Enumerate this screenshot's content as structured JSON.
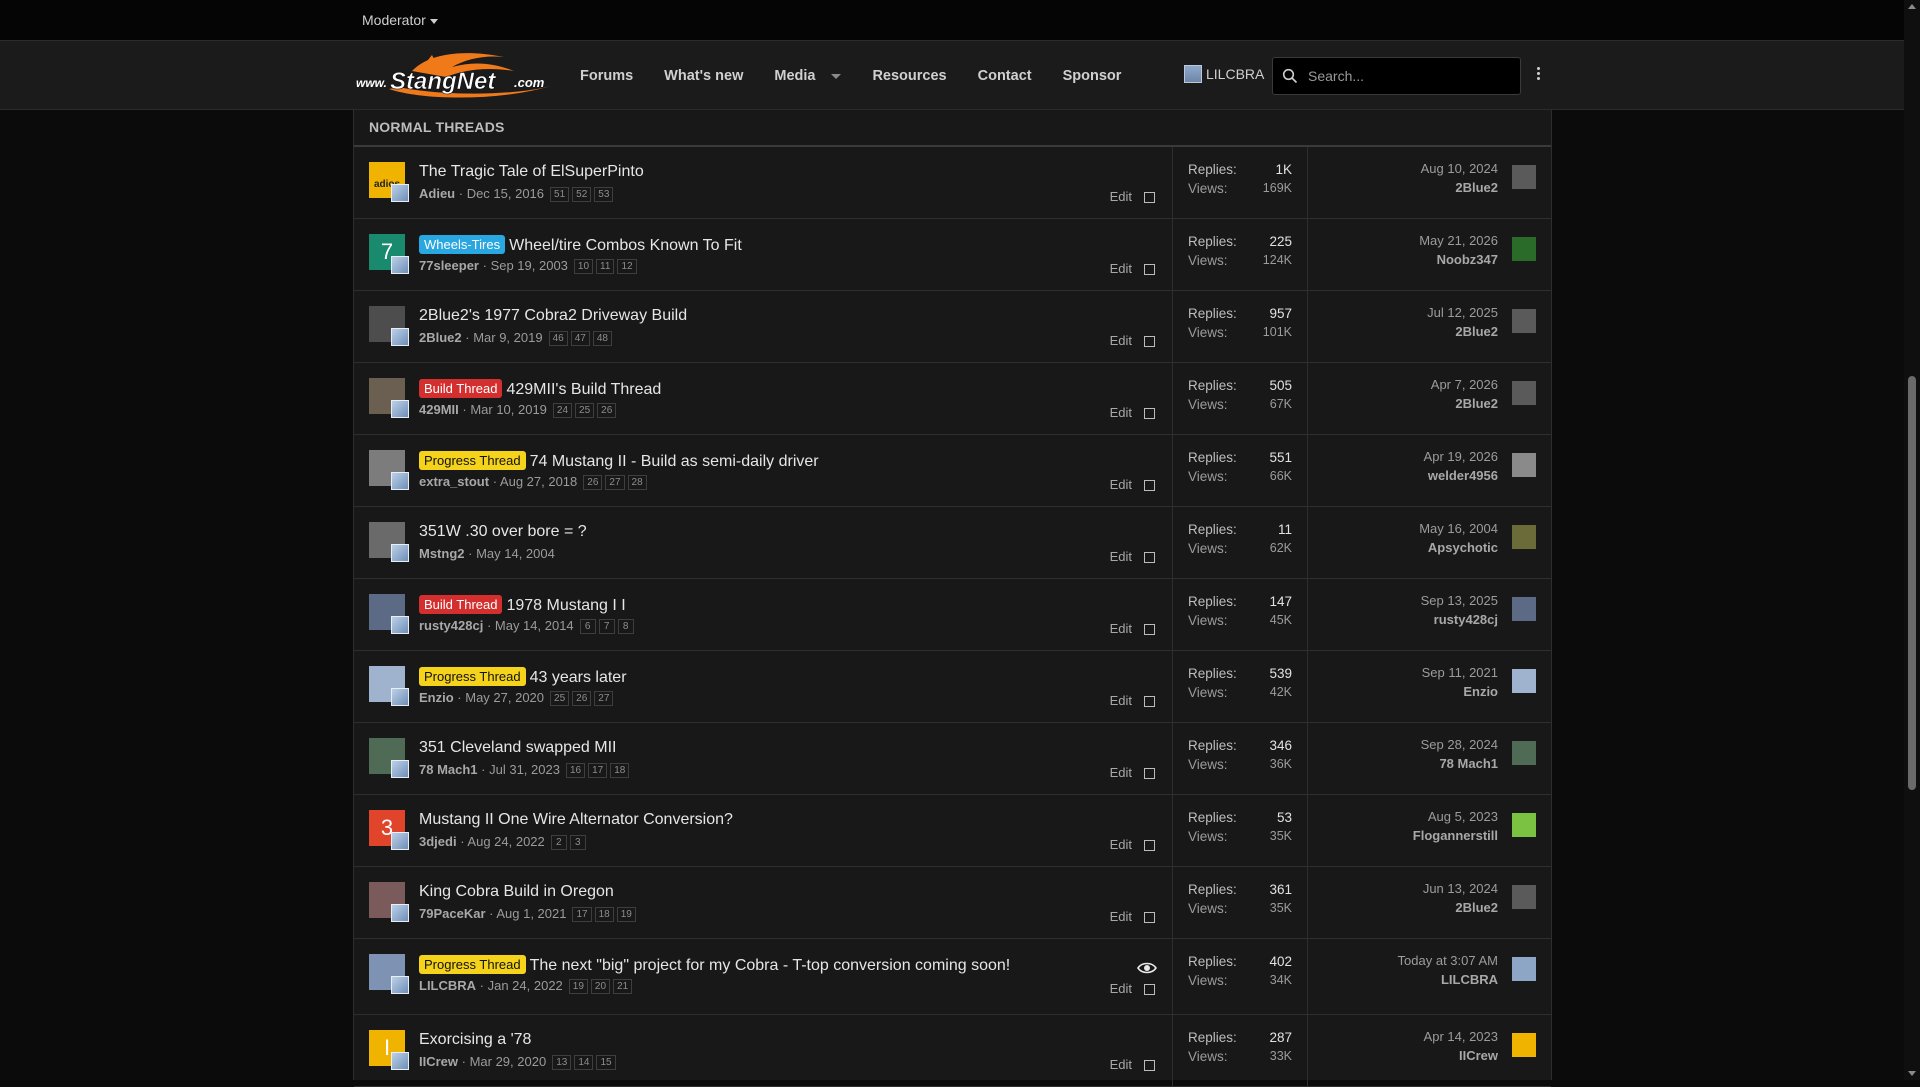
{
  "topbar": {
    "moderator_label": "Moderator"
  },
  "nav": {
    "logo_text": "www.StangNet.com",
    "items": [
      "Forums",
      "What's new",
      "Media",
      "Resources",
      "Contact",
      "Sponsor"
    ],
    "username": "LILCBRA",
    "search_placeholder": "Search..."
  },
  "section_title": "NORMAL THREADS",
  "edit_label": "Edit",
  "replies_label": "Replies:",
  "views_label": "Views:",
  "colors": {
    "background": "#181818",
    "wheels_tires_prefix": "#29a7e1",
    "build_thread_prefix": "#d32f2f",
    "progress_thread_prefix": "#f5d31b"
  },
  "threads": [
    {
      "title": "The Tragic Tale of ElSuperPinto",
      "prefix": "",
      "author": "Adieu",
      "date": "Dec 15, 2016",
      "pages": [
        "51",
        "52",
        "53"
      ],
      "replies": "1K",
      "views": "169K",
      "last_date": "Aug 10, 2024",
      "last_user": "2Blue2",
      "avatar_letter": "adios",
      "avatar_color": "#f0b400",
      "last_avatar_color": "#5a5a5a",
      "watched": false
    },
    {
      "title": "Wheel/tire Combos Known To Fit",
      "prefix": "Wheels-Tires",
      "author": "77sleeper",
      "date": "Sep 19, 2003",
      "pages": [
        "10",
        "11",
        "12"
      ],
      "replies": "225",
      "views": "124K",
      "last_date": "May 21, 2026",
      "last_user": "Noobz347",
      "avatar_letter": "7",
      "avatar_color": "#1a8a6e",
      "last_avatar_color": "#2a6b2a",
      "watched": false
    },
    {
      "title": "2Blue2's 1977 Cobra2 Driveway Build",
      "prefix": "",
      "author": "2Blue2",
      "date": "Mar 9, 2019",
      "pages": [
        "46",
        "47",
        "48"
      ],
      "replies": "957",
      "views": "101K",
      "last_date": "Jul 12, 2025",
      "last_user": "2Blue2",
      "avatar_letter": "",
      "avatar_color": "#4d4d4d",
      "last_avatar_color": "#5a5a5a",
      "watched": false
    },
    {
      "title": "429MII's Build Thread",
      "prefix": "Build Thread",
      "author": "429MII",
      "date": "Mar 10, 2019",
      "pages": [
        "24",
        "25",
        "26"
      ],
      "replies": "505",
      "views": "67K",
      "last_date": "Apr 7, 2026",
      "last_user": "2Blue2",
      "avatar_letter": "",
      "avatar_color": "#6b5f52",
      "last_avatar_color": "#5a5a5a",
      "watched": false
    },
    {
      "title": "74 Mustang II - Build as semi-daily driver",
      "prefix": "Progress Thread",
      "author": "extra_stout",
      "date": "Aug 27, 2018",
      "pages": [
        "26",
        "27",
        "28"
      ],
      "replies": "551",
      "views": "66K",
      "last_date": "Apr 19, 2026",
      "last_user": "welder4956",
      "avatar_letter": "",
      "avatar_color": "#7c7c7c",
      "last_avatar_color": "#8a8a8a",
      "watched": false
    },
    {
      "title": "351W .30 over bore = ?",
      "prefix": "",
      "author": "Mstng2",
      "date": "May 14, 2004",
      "pages": [],
      "replies": "11",
      "views": "62K",
      "last_date": "May 16, 2004",
      "last_user": "Apsychotic",
      "avatar_letter": "",
      "avatar_color": "#6a6a6a",
      "last_avatar_color": "#6b6b3a",
      "watched": false
    },
    {
      "title": "1978 Mustang I I",
      "prefix": "Build Thread",
      "author": "rusty428cj",
      "date": "May 14, 2014",
      "pages": [
        "6",
        "7",
        "8"
      ],
      "replies": "147",
      "views": "45K",
      "last_date": "Sep 13, 2025",
      "last_user": "rusty428cj",
      "avatar_letter": "",
      "avatar_color": "#5d6a86",
      "last_avatar_color": "#5d6a86",
      "watched": false
    },
    {
      "title": "43 years later",
      "prefix": "Progress Thread",
      "author": "Enzio",
      "date": "May 27, 2020",
      "pages": [
        "25",
        "26",
        "27"
      ],
      "replies": "539",
      "views": "42K",
      "last_date": "Sep 11, 2021",
      "last_user": "Enzio",
      "avatar_letter": "",
      "avatar_color": "#9fb3cf",
      "last_avatar_color": "#9fb3cf",
      "watched": false
    },
    {
      "title": "351 Cleveland swapped MII",
      "prefix": "",
      "author": "78 Mach1",
      "date": "Jul 31, 2023",
      "pages": [
        "16",
        "17",
        "18"
      ],
      "replies": "346",
      "views": "36K",
      "last_date": "Sep 28, 2024",
      "last_user": "78 Mach1",
      "avatar_letter": "",
      "avatar_color": "#4f6a55",
      "last_avatar_color": "#4f6a55",
      "watched": false
    },
    {
      "title": "Mustang II One Wire Alternator Conversion?",
      "prefix": "",
      "author": "3djedi",
      "date": "Aug 24, 2022",
      "pages": [
        "2",
        "3"
      ],
      "replies": "53",
      "views": "35K",
      "last_date": "Aug 5, 2023",
      "last_user": "Flogannerstill",
      "avatar_letter": "3",
      "avatar_color": "#e0442a",
      "last_avatar_color": "#7cc242",
      "watched": false
    },
    {
      "title": "King Cobra Build in Oregon",
      "prefix": "",
      "author": "79PaceKar",
      "date": "Aug 1, 2021",
      "pages": [
        "17",
        "18",
        "19"
      ],
      "replies": "361",
      "views": "35K",
      "last_date": "Jun 13, 2024",
      "last_user": "2Blue2",
      "avatar_letter": "",
      "avatar_color": "#7a5a5a",
      "last_avatar_color": "#5a5a5a",
      "watched": false
    },
    {
      "title": "The next \"big\" project for my Cobra - T-top conversion coming soon!",
      "prefix": "Progress Thread",
      "author": "LILCBRA",
      "date": "Jan 24, 2022",
      "pages": [
        "19",
        "20",
        "21"
      ],
      "replies": "402",
      "views": "34K",
      "last_date": "Today at 3:07 AM",
      "last_user": "LILCBRA",
      "avatar_letter": "",
      "avatar_color": "#7e93b3",
      "last_avatar_color": "#8ea6c6",
      "watched": true
    },
    {
      "title": "Exorcising a '78",
      "prefix": "",
      "author": "IICrew",
      "date": "Mar 29, 2020",
      "pages": [
        "13",
        "14",
        "15"
      ],
      "replies": "287",
      "views": "33K",
      "last_date": "Apr 14, 2023",
      "last_user": "IICrew",
      "avatar_letter": "I",
      "avatar_color": "#f0b400",
      "last_avatar_color": "#f0b400",
      "watched": false
    }
  ]
}
